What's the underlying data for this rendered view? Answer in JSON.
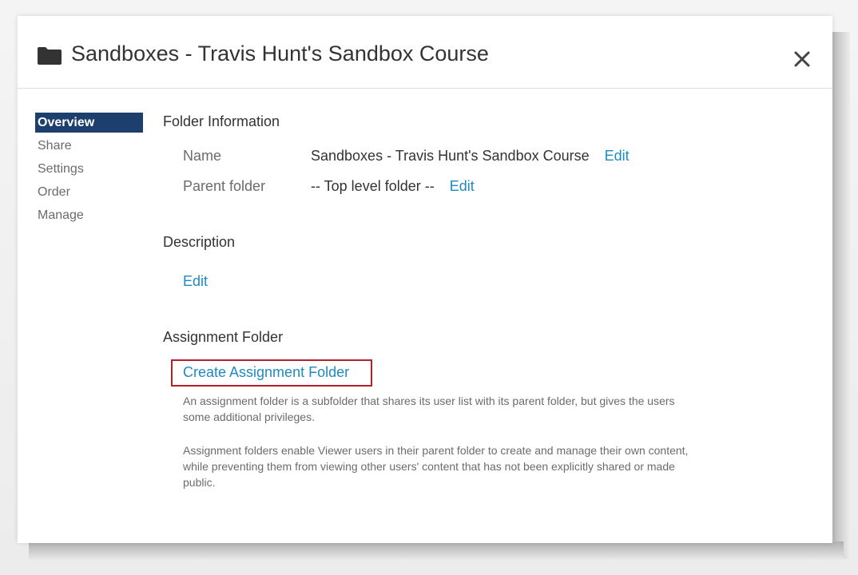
{
  "dialog": {
    "title": "Sandboxes - Travis Hunt's Sandbox Course",
    "icons": {
      "title": "folder-icon",
      "close": "close-icon"
    }
  },
  "sidebar": {
    "items": [
      {
        "label": "Overview",
        "active": true
      },
      {
        "label": "Share",
        "active": false
      },
      {
        "label": "Settings",
        "active": false
      },
      {
        "label": "Order",
        "active": false
      },
      {
        "label": "Manage",
        "active": false
      }
    ]
  },
  "folder_info": {
    "heading": "Folder Information",
    "name_label": "Name",
    "name_value": "Sandboxes - Travis Hunt's Sandbox Course",
    "name_edit": "Edit",
    "parent_label": "Parent folder",
    "parent_value": "-- Top level folder --",
    "parent_edit": "Edit"
  },
  "description": {
    "heading": "Description",
    "edit": "Edit"
  },
  "assignment": {
    "heading": "Assignment Folder",
    "create_link": "Create Assignment Folder",
    "para1": "An assignment folder is a subfolder that shares its user list with its parent folder, but gives the users some additional privileges.",
    "para2": "Assignment folders enable Viewer users in their parent folder to create and manage their own content, while preventing them from viewing other users' content that has not been explicitly shared or made public."
  },
  "colors": {
    "accent_link": "#1f8ac0",
    "nav_active_bg": "#1d3f6e",
    "highlight": "#b2202a"
  }
}
